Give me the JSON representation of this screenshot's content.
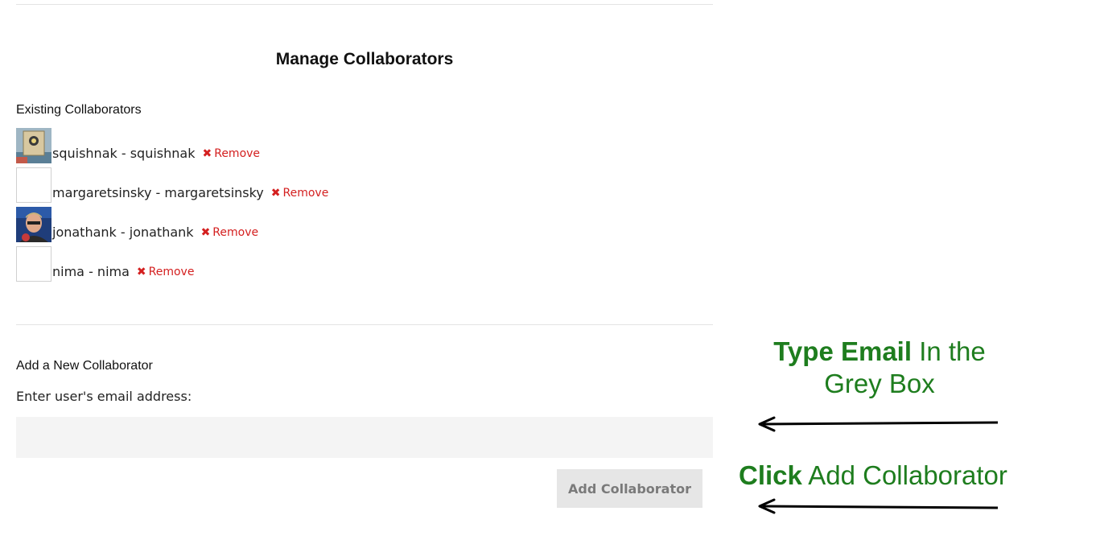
{
  "page": {
    "title": "Manage Collaborators"
  },
  "existing": {
    "heading": "Existing Collaborators",
    "remove_label": "Remove",
    "collaborators": [
      {
        "name": "squishnak - squishnak",
        "avatar": "photo"
      },
      {
        "name": "margaretsinsky - margaretsinsky",
        "avatar": "blank"
      },
      {
        "name": "jonathank - jonathank",
        "avatar": "photo"
      },
      {
        "name": "nima - nima",
        "avatar": "blank"
      }
    ]
  },
  "add_new": {
    "heading": "Add a New Collaborator",
    "prompt": "Enter user's email address:",
    "email_value": "",
    "button_label": "Add Collaborator"
  },
  "annotations": {
    "type_email_bold": "Type Email",
    "type_email_rest": "In the",
    "type_email_line2": "Grey Box",
    "click_bold": "Click",
    "click_rest": "Add Collaborator",
    "color": "#1e7d1e"
  },
  "colors": {
    "remove": "#d42020",
    "input_bg": "#f4f4f4",
    "button_bg": "#e6e6e6"
  },
  "icons": {
    "remove": "x-icon",
    "arrow": "left-arrow-icon"
  }
}
